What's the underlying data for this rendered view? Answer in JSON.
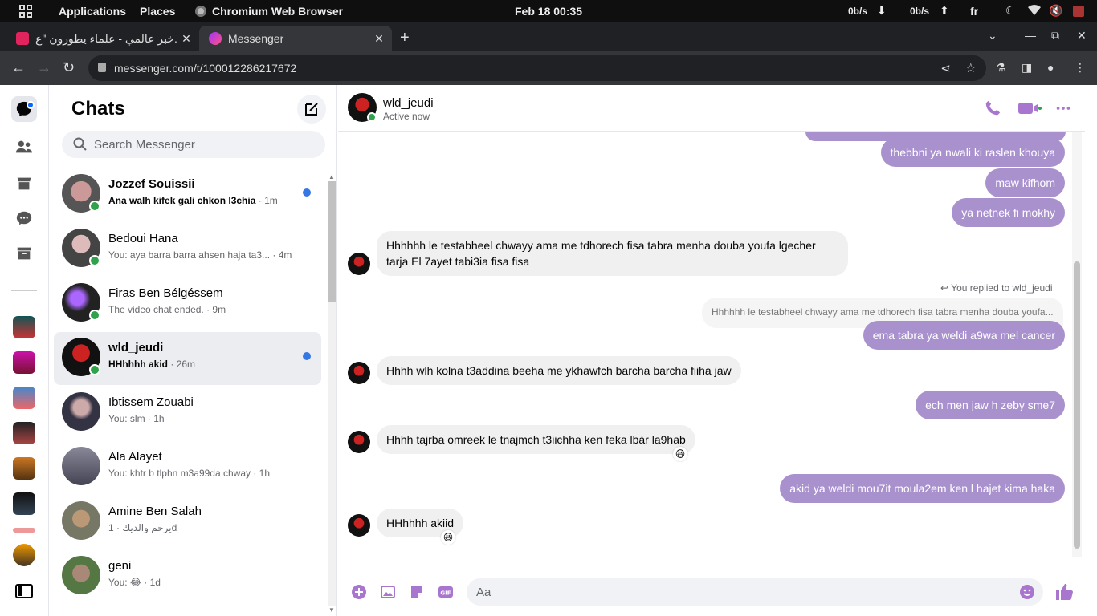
{
  "system_bar": {
    "applications": "Applications",
    "places": "Places",
    "active_app": "Chromium Web Browser",
    "clock": "Feb 18  00:35",
    "net_down": "0b/s",
    "net_up": "0b/s",
    "lang": "fr"
  },
  "browser": {
    "tabs": [
      {
        "title": "خبر عالمي - علماء يطورون \"ع..."
      },
      {
        "title": "Messenger"
      }
    ],
    "url": "messenger.com/t/100012286217672"
  },
  "chats": {
    "title": "Chats",
    "search_placeholder": "Search Messenger",
    "list": [
      {
        "name": "Jozzef Souissii",
        "preview": "Ana walh kifek gali chkon l3chia",
        "time": " · 1m",
        "unread": true,
        "online": true
      },
      {
        "name": "Bedoui Hana",
        "preview": "You: aya barra barra ahsen haja ta3...",
        "time": " · 4m",
        "unread": false,
        "online": true
      },
      {
        "name": "Firas Ben Bélgéssem",
        "preview": "The video chat ended.",
        "time": " · 9m",
        "unread": false,
        "online": true
      },
      {
        "name": "wld_jeudi",
        "preview": "HHhhhh akid",
        "time": " · 26m",
        "unread": true,
        "online": true,
        "selected": true
      },
      {
        "name": "Ibtissem Zouabi",
        "preview": "You: slm",
        "time": " · 1h",
        "unread": false,
        "online": false
      },
      {
        "name": "Ala Alayet",
        "preview": "You: khtr b tlphn m3a99da chway",
        "time": " · 1h",
        "unread": false,
        "online": false
      },
      {
        "name": "Amine Ben Salah",
        "preview": "يرحم والديك",
        "time": " · 1d",
        "unread": false,
        "online": false
      },
      {
        "name": "geni",
        "preview": "You: 😂",
        "time": " · 1d",
        "unread": false,
        "online": false
      }
    ]
  },
  "conversation": {
    "contact_name": "wld_jeudi",
    "status": "Active now",
    "messages": [
      {
        "from": "me",
        "text": "thebbni ya nwali ki raslen khouya"
      },
      {
        "from": "me",
        "text": "maw kifhom"
      },
      {
        "from": "me",
        "text": "ya netnek fi mokhy"
      },
      {
        "from": "them",
        "text": "Hhhhhh le testabheel chwayy ama me tdhorech fisa tabra menha douba youfa lgecher",
        "text2": "tarja El 7ayet tabi3ia fisa fisa"
      },
      {
        "from": "meta",
        "text": "You replied to wld_jeudi"
      },
      {
        "from": "quote",
        "text": "Hhhhhh le testabheel chwayy ama me tdhorech fisa tabra menha douba youfa..."
      },
      {
        "from": "me",
        "text": "ema tabra ya weldi a9wa mel cancer"
      },
      {
        "from": "them",
        "text": "Hhhh wlh kolna t3addina beeha me ykhawfch barcha barcha fiiha jaw"
      },
      {
        "from": "me",
        "text": "ech men jaw h zeby sme7"
      },
      {
        "from": "them",
        "text": "Hhhh tajrba omreek le tnajmch t3iichha ken feka lbàr la9hab",
        "reaction": "😆"
      },
      {
        "from": "me",
        "text": "akid ya weldi mou7it moula2em ken l hajet kima haka"
      },
      {
        "from": "them",
        "text": "HHhhhh akiid",
        "reaction": "😆"
      }
    ],
    "composer_placeholder": "Aa"
  },
  "colors": {
    "accent": "#a876cf",
    "my_bubble": "#a991ce",
    "online": "#31a24c",
    "unread_dot": "#3578e5"
  }
}
